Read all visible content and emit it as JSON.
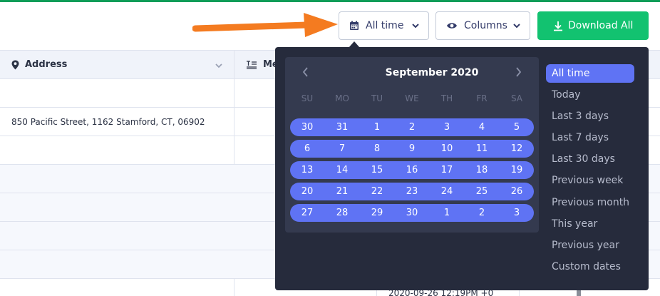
{
  "toolbar": {
    "date_filter_label": "All time",
    "columns_label": "Columns",
    "download_label": "Download All"
  },
  "table": {
    "columns": [
      "Address",
      "Me"
    ],
    "rows": [
      {
        "address": ""
      },
      {
        "address": "850 Pacific Street, 1162 Stamford, CT, 06902"
      },
      {
        "address": ""
      },
      {
        "address": ""
      },
      {
        "address": ""
      },
      {
        "address": ""
      },
      {
        "address": ""
      }
    ],
    "partial_cell_text": "2020-09-26 12:19PM +0"
  },
  "date_picker": {
    "month_label": "September 2020",
    "weekdays": [
      "SU",
      "MO",
      "TU",
      "WE",
      "TH",
      "FR",
      "SA"
    ],
    "weeks": [
      [
        "30",
        "31",
        "1",
        "2",
        "3",
        "4",
        "5"
      ],
      [
        "6",
        "7",
        "8",
        "9",
        "10",
        "11",
        "12"
      ],
      [
        "13",
        "14",
        "15",
        "16",
        "17",
        "18",
        "19"
      ],
      [
        "20",
        "21",
        "22",
        "23",
        "24",
        "25",
        "26"
      ],
      [
        "27",
        "28",
        "29",
        "30",
        "1",
        "2",
        "3"
      ]
    ],
    "presets": [
      "All time",
      "Today",
      "Last 3 days",
      "Last 7 days",
      "Last 30 days",
      "Previous week",
      "Previous month",
      "This year",
      "Previous year",
      "Custom dates"
    ],
    "active_preset": "All time"
  },
  "colors": {
    "accent_green": "#12c270",
    "range_blue": "#5f73f4",
    "popover_bg": "#262b3c",
    "annotation_arrow": "#f47b20"
  },
  "icons": {
    "date_filter": "calendar-icon",
    "columns": "eye-icon",
    "download": "download-icon",
    "address_column": "map-pin-icon",
    "next_column": "text-lines-icon"
  }
}
